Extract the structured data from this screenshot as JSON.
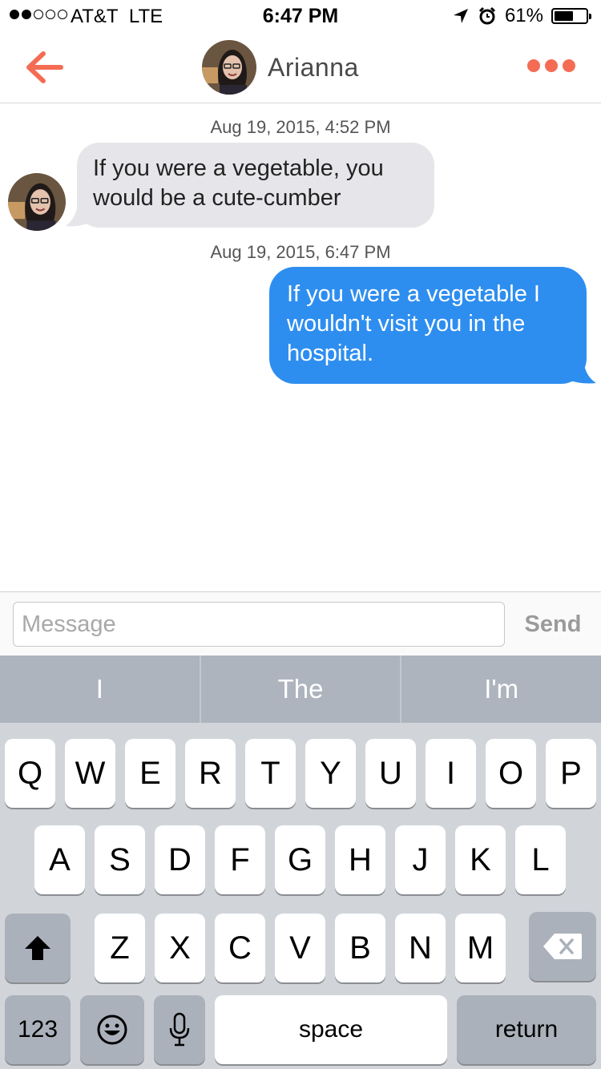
{
  "status_bar": {
    "carrier": "AT&T",
    "network": "LTE",
    "time": "6:47 PM",
    "battery": "61%",
    "battery_level": 0.61
  },
  "nav": {
    "contact_name": "Arianna"
  },
  "messages": [
    {
      "timestamp": "Aug 19, 2015, 4:52 PM",
      "direction": "incoming",
      "text": "If you were a vegetable, you would be a cute-cumber"
    },
    {
      "timestamp": "Aug 19, 2015, 6:47 PM",
      "direction": "outgoing",
      "text": "If you were a vegetable I wouldn't visit you in the hospital."
    }
  ],
  "composer": {
    "placeholder": "Message",
    "send_label": "Send"
  },
  "suggestions": [
    "I",
    "The",
    "I'm"
  ],
  "keyboard": {
    "row1": [
      "Q",
      "W",
      "E",
      "R",
      "T",
      "Y",
      "U",
      "I",
      "O",
      "P"
    ],
    "row2": [
      "A",
      "S",
      "D",
      "F",
      "G",
      "H",
      "J",
      "K",
      "L"
    ],
    "row3": [
      "Z",
      "X",
      "C",
      "V",
      "B",
      "N",
      "M"
    ],
    "numbers_label": "123",
    "space_label": "space",
    "return_label": "return"
  },
  "colors": {
    "accent": "#f46c54",
    "outgoing_bubble": "#2e8ef0",
    "incoming_bubble": "#e6e6ea"
  }
}
